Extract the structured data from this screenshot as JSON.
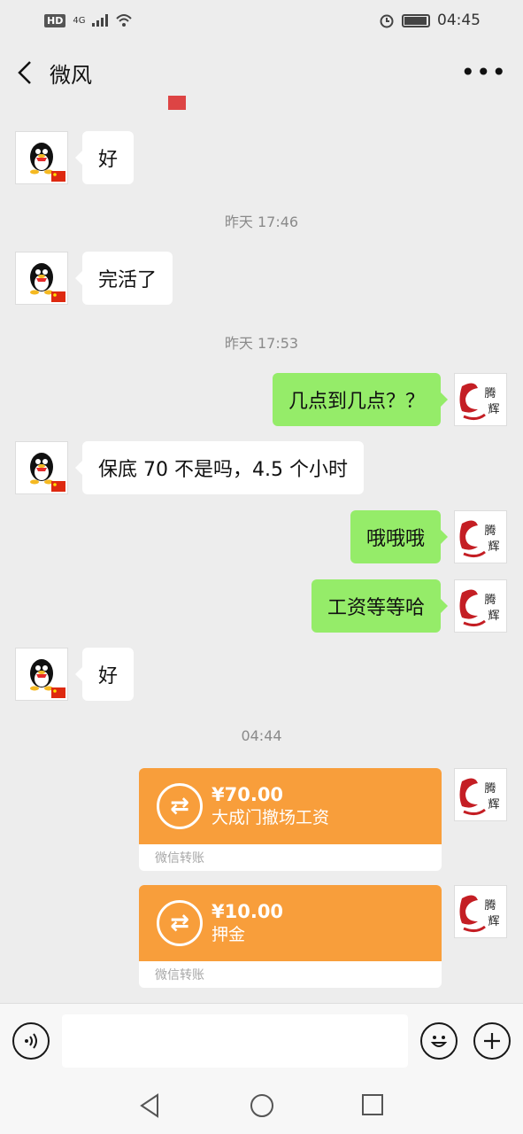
{
  "status": {
    "hd": "HD",
    "network": "4G",
    "time": "04:45"
  },
  "header": {
    "title": "微风"
  },
  "messages": [
    {
      "text": "好"
    },
    {
      "time": "昨天 17:46"
    },
    {
      "text": "完活了"
    },
    {
      "time": "昨天 17:53"
    },
    {
      "text": "几点到几点？？"
    },
    {
      "text": "保底 70 不是吗，4.5 个小时"
    },
    {
      "text": "哦哦哦"
    },
    {
      "text": "工资等等哈"
    },
    {
      "text": "好"
    },
    {
      "time": "04:44"
    },
    {
      "amount": "¥70.00",
      "note": "大成门撤场工资",
      "label": "微信转账"
    },
    {
      "amount": "¥10.00",
      "note": "押金",
      "label": "微信转账"
    }
  ],
  "avatar_text": {
    "line1": "腾",
    "line2": "辉"
  },
  "colors": {
    "sent": "#95ec69",
    "received": "#ffffff",
    "transfer": "#f89e3b",
    "background": "#ededed"
  },
  "icons": {
    "back": "back-arrow-icon",
    "more": "more-dots-icon",
    "voice": "voice-icon",
    "emoji": "emoji-icon",
    "add": "plus-icon",
    "transfer": "transfer-arrows-icon"
  }
}
